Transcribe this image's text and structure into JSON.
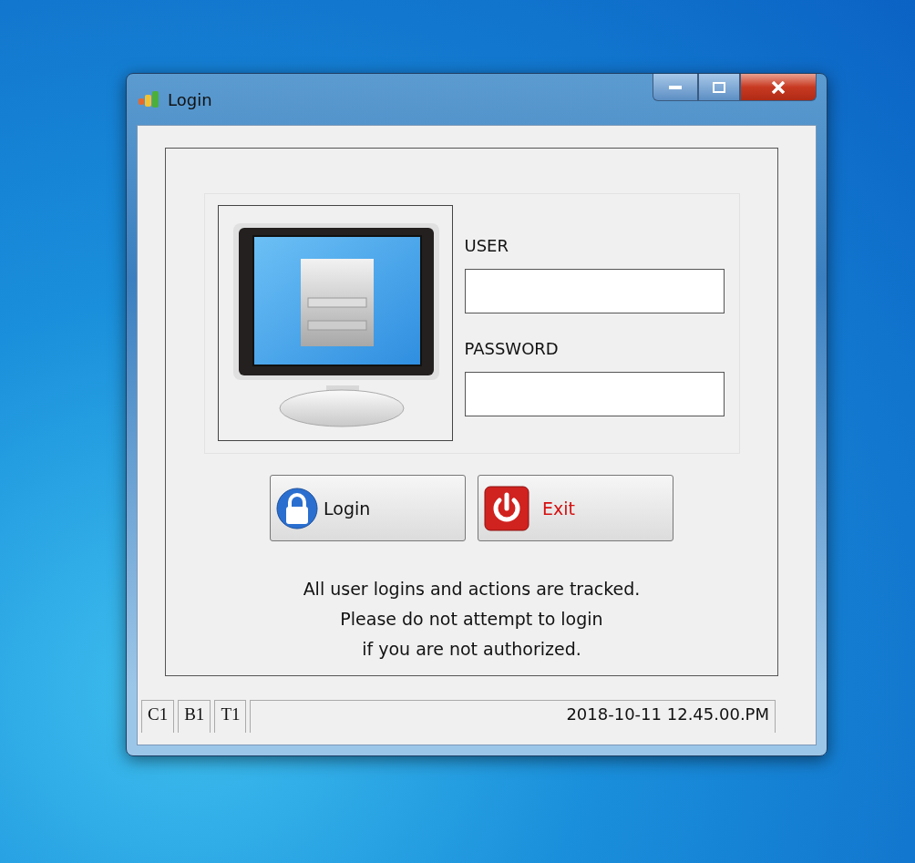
{
  "window": {
    "title": "Login"
  },
  "fields": [
    {
      "label": "USER"
    },
    {
      "label": "PASSWORD"
    }
  ],
  "buttons": [
    {
      "label": "Login",
      "kind": "login"
    },
    {
      "label": "Exit",
      "kind": "exit"
    }
  ],
  "notice": [
    "All user logins and actions are tracked.",
    "Please do not attempt to login",
    "if you are not authorized."
  ],
  "status_bar": [
    "C1",
    "B1",
    "T1",
    "2018-10-11 12.45.00.PM"
  ]
}
